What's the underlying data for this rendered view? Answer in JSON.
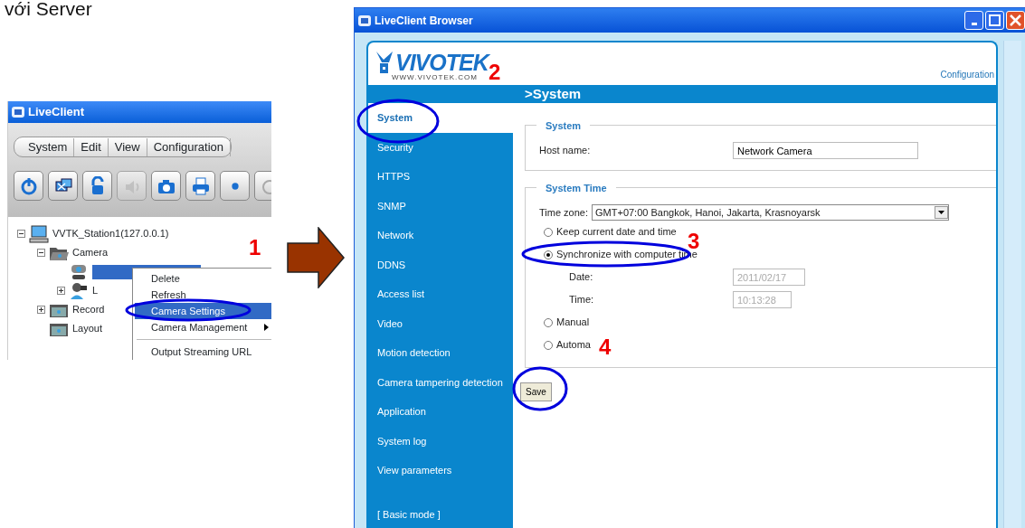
{
  "heading": "với Server",
  "liveclient": {
    "title": "LiveClient",
    "menu": [
      "System",
      "Edit",
      "View",
      "Configuration"
    ],
    "toolbar": [
      {
        "kind": "power",
        "disabled": false
      },
      {
        "kind": "monitor",
        "disabled": false
      },
      {
        "kind": "lock",
        "disabled": false
      },
      {
        "kind": "speaker",
        "disabled": true
      },
      {
        "kind": "camera",
        "disabled": false
      },
      {
        "kind": "printer",
        "disabled": false
      },
      {
        "kind": "record",
        "disabled": false
      },
      {
        "kind": "partial",
        "disabled": false
      }
    ],
    "tree": [
      {
        "kind": "computer",
        "label": "VVTK_Station1(127.0.0.1)",
        "expanded": true,
        "selected": false,
        "children": [
          {
            "kind": "folder-open",
            "label": "Camera",
            "expanded": true,
            "selected": false,
            "children": [
              {
                "kind": "camera",
                "selected": true
              },
              {
                "kind": "camera-person",
                "label": "L",
                "expanded": false,
                "selected": false
              }
            ]
          },
          {
            "kind": "folder",
            "label": "Record",
            "expanded": false,
            "selected": false
          },
          {
            "kind": "folder",
            "label": "Layout",
            "selected": false
          }
        ]
      }
    ],
    "context_menu": [
      {
        "label": "Delete",
        "selected": false,
        "submenu": false
      },
      {
        "label": "Refresh",
        "selected": false,
        "submenu": false
      },
      {
        "label": "Camera Settings",
        "selected": true,
        "submenu": false
      },
      {
        "label": "Camera Management",
        "selected": false,
        "submenu": true
      },
      {
        "label": "Output Streaming URL",
        "selected": false,
        "submenu": false,
        "separator_before": true
      }
    ]
  },
  "browser": {
    "title": "LiveClient Browser",
    "logo": {
      "name": "VIVOTEK",
      "url": "WWW.VIVOTEK.COM"
    },
    "config_link": "Configuration",
    "section_title": ">System",
    "sidebar": [
      {
        "label": "System",
        "selected": true
      },
      {
        "label": "Security",
        "selected": false
      },
      {
        "label": "HTTPS",
        "selected": false
      },
      {
        "label": "SNMP",
        "selected": false
      },
      {
        "label": "Network",
        "selected": false
      },
      {
        "label": "DDNS",
        "selected": false
      },
      {
        "label": "Access list",
        "selected": false
      },
      {
        "label": "Video",
        "selected": false
      },
      {
        "label": "Motion detection",
        "selected": false
      },
      {
        "label": "Camera tampering detection",
        "selected": false
      },
      {
        "label": "Application",
        "selected": false
      },
      {
        "label": "System log",
        "selected": false
      },
      {
        "label": "View parameters",
        "selected": false
      }
    ],
    "basic_mode": "[ Basic mode ]",
    "system": {
      "legend": "System",
      "host_label": "Host name:",
      "host_value": "Network Camera"
    },
    "system_time": {
      "legend": "System Time",
      "timezone_label": "Time zone:",
      "timezone_value": "GMT+07:00 Bangkok, Hanoi, Jakarta, Krasnoyarsk",
      "options": [
        {
          "label": "Keep current date and time",
          "selected": false
        },
        {
          "label": "Synchronize with computer time",
          "selected": true,
          "fields": [
            {
              "label": "Date:",
              "value": "2011/02/17"
            },
            {
              "label": "Time:",
              "value": "10:13:28"
            }
          ]
        },
        {
          "label": "Manual",
          "selected": false
        },
        {
          "label": "Automa",
          "selected": false
        }
      ]
    },
    "save": "Save"
  },
  "steps": [
    "1",
    "2",
    "3",
    "4"
  ]
}
